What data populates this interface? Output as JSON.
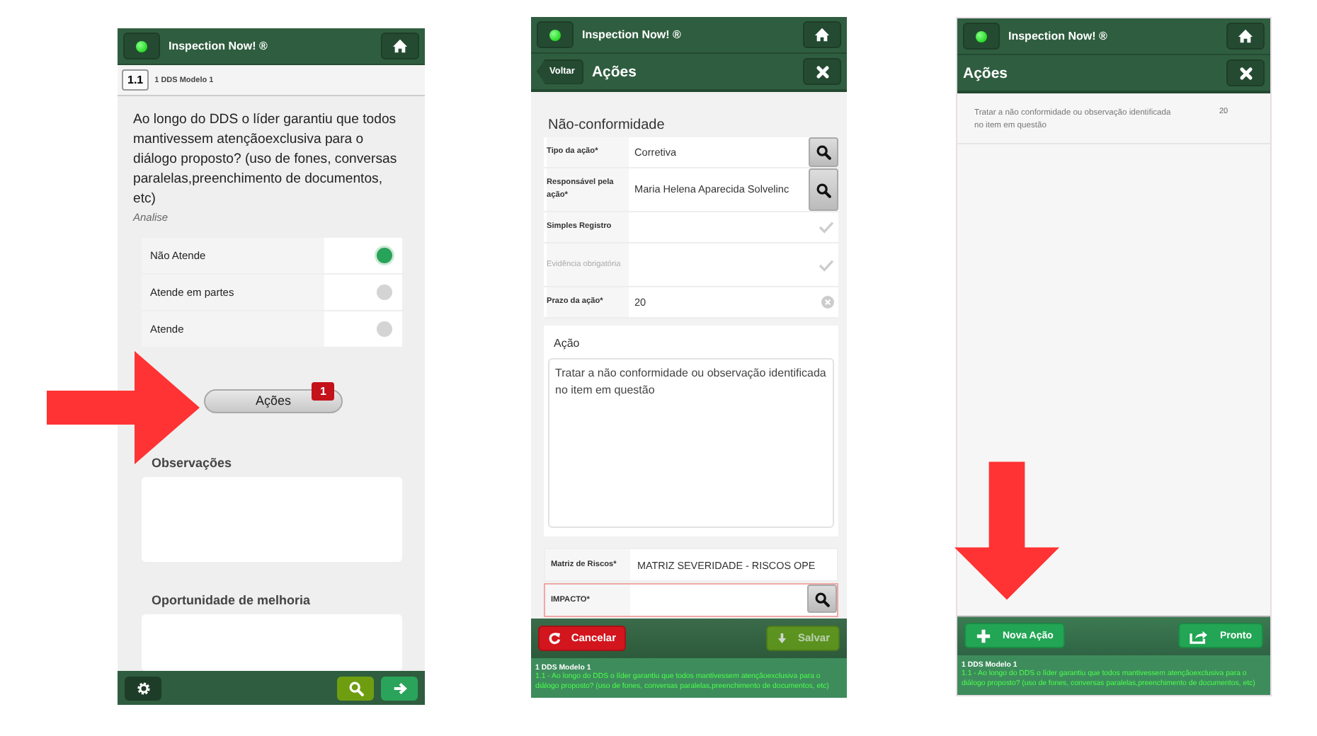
{
  "screens": [
    {
      "kind": "question",
      "header": {
        "title": "Inspection Now! ®"
      },
      "breadcrumb": {
        "code": "1.1",
        "label": "1 DDS Modelo 1"
      },
      "question": "Ao longo do DDS o líder garantiu que todos mantivessem atençãoexclusiva para o diálogo proposto? (uso de fones, conversas paralelas,preenchimento de documentos, etc)",
      "hint": "Analise",
      "options": [
        {
          "label": "Não Atende",
          "selected": true
        },
        {
          "label": "Atende em partes",
          "selected": false
        },
        {
          "label": "Atende",
          "selected": false
        }
      ],
      "actions_button": {
        "label": "Ações",
        "badge": "1"
      },
      "fields": [
        {
          "label": "Observações"
        },
        {
          "label": "Oportunidade de melhoria"
        }
      ]
    },
    {
      "kind": "action_form",
      "header": {
        "title": "Inspection Now! ®"
      },
      "subheader": {
        "back": "Voltar",
        "title": "Ações"
      },
      "section": "Não-conformidade",
      "fields": [
        {
          "label": "Tipo da ação*",
          "value": "Corretiva",
          "kind": "lookup"
        },
        {
          "label": "Responsável pela ação*",
          "value": "Maria Helena Aparecida Solvelinc",
          "kind": "lookup"
        },
        {
          "label": "Simples Registro",
          "kind": "toggle",
          "checked": false,
          "disabled": false
        },
        {
          "label": "Evidência obrigatória",
          "kind": "toggle",
          "checked": false,
          "disabled": true
        },
        {
          "label": "Prazo da ação*",
          "value": "20",
          "kind": "clear"
        }
      ],
      "action": {
        "label": "Ação",
        "value": "Tratar a não conformidade ou observação identificada no item em questão"
      },
      "risk_fields": [
        {
          "label": "Matriz de Riscos*",
          "value": "MATRIZ SEVERIDADE - RISCOS OPE",
          "kind": "text",
          "invalid": false
        },
        {
          "label": "IMPACTO*",
          "kind": "lookup",
          "invalid": true
        }
      ],
      "buttons": [
        {
          "label": "Cancelar",
          "kind": "cancel",
          "disabled": false
        },
        {
          "label": "Salvar",
          "kind": "save",
          "disabled": true
        }
      ],
      "status": {
        "title": "1 DDS Modelo 1",
        "text": "1.1 - Ao longo do DDS o líder garantiu que todos mantivessem atençãoexclusiva para o diálogo proposto? (uso de fones, conversas paralelas,preenchimento de documentos, etc)"
      }
    },
    {
      "kind": "action_list",
      "header": {
        "title": "Inspection Now! ®"
      },
      "subheader": {
        "title": "Ações"
      },
      "items": [
        {
          "text": "Tratar a não conformidade ou observação identificada no item em questão",
          "deadline": "20"
        }
      ],
      "buttons": [
        {
          "label": "Nova Ação",
          "kind": "add",
          "disabled": false
        },
        {
          "label": "Pronto",
          "kind": "done",
          "disabled": false
        }
      ],
      "status": {
        "title": "1 DDS Modelo 1",
        "text": "1.1 - Ao longo do DDS o líder garantiu que todos mantivessem atençãoexclusiva para o diálogo proposto? (uso de fones, conversas paralelas,preenchimento de documentos, etc)"
      }
    }
  ]
}
